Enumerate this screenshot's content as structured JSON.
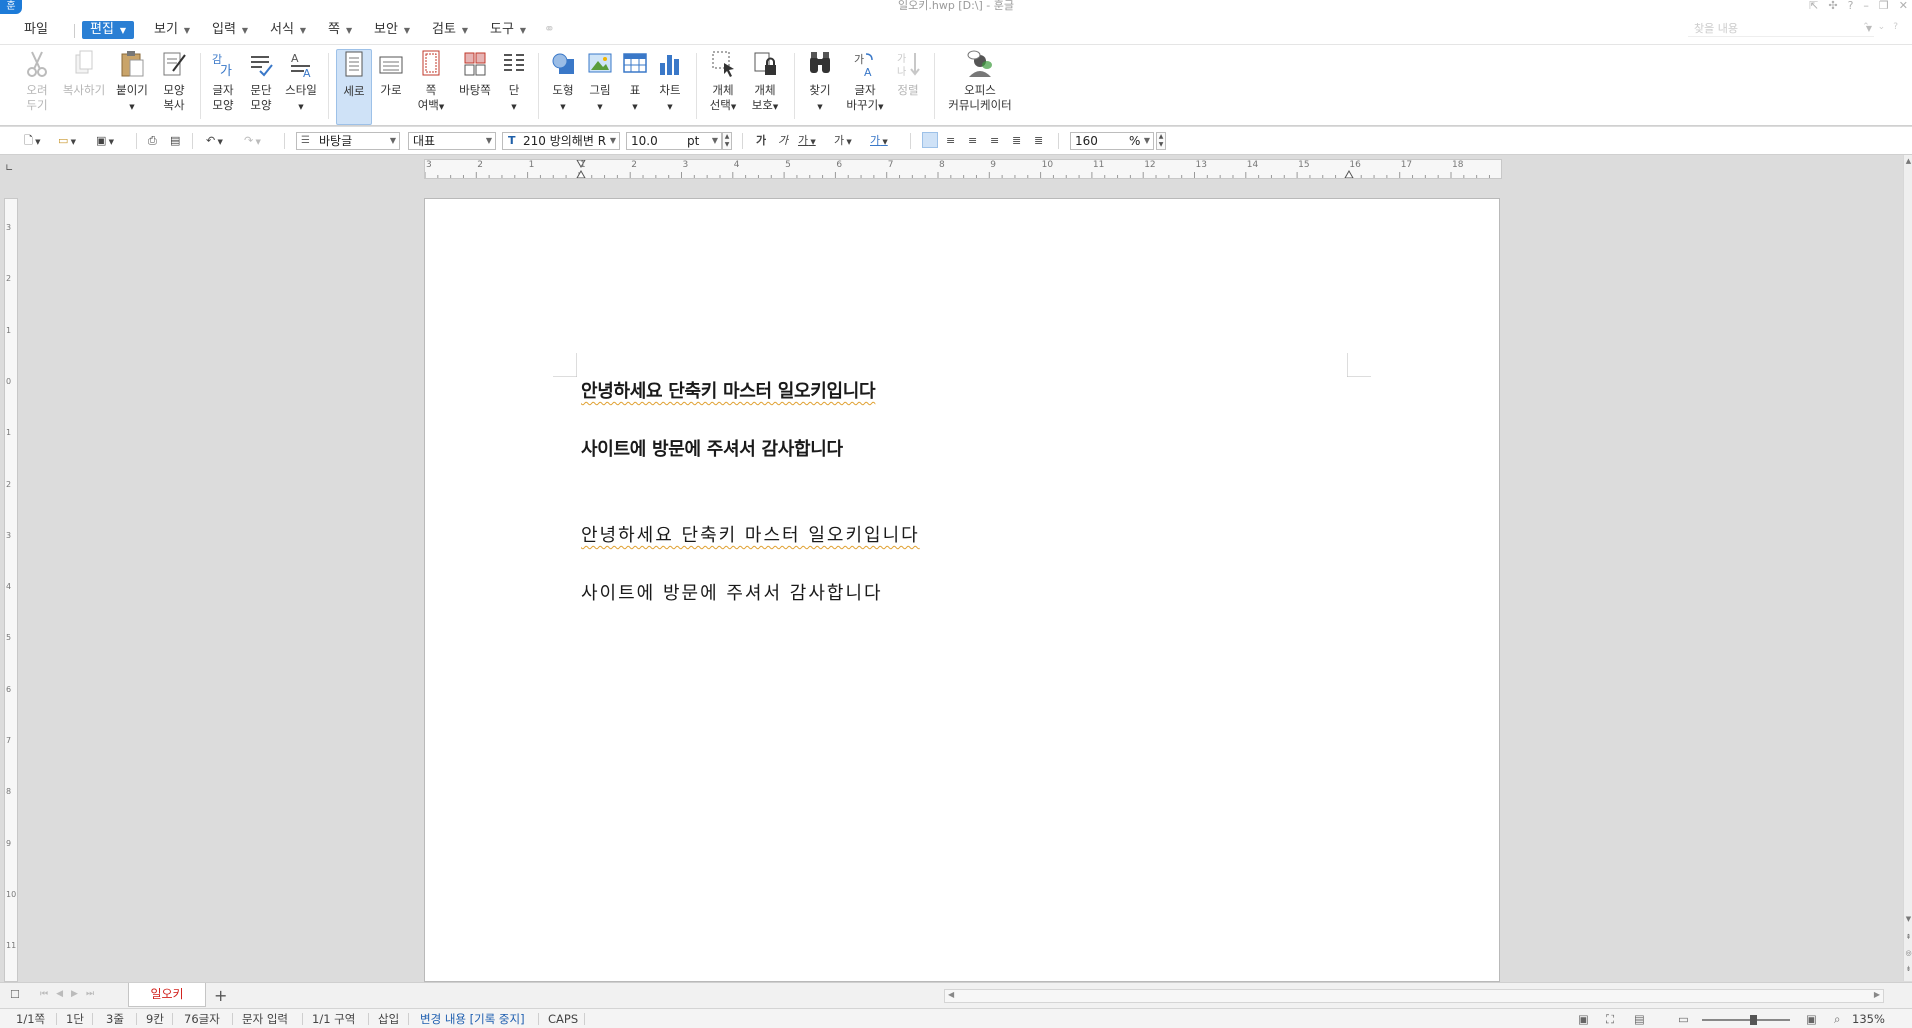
{
  "window": {
    "logo": "훈",
    "title": "일오키.hwp [D:\\] - 훈글",
    "controls": [
      "⇱",
      "✣",
      "?",
      "–",
      "❐",
      "✕"
    ]
  },
  "menu": {
    "file": "파일",
    "items": [
      {
        "label": "편집",
        "active": true
      },
      {
        "label": "보기"
      },
      {
        "label": "입력"
      },
      {
        "label": "서식"
      },
      {
        "label": "쪽"
      },
      {
        "label": "보안"
      },
      {
        "label": "검토"
      },
      {
        "label": "도구"
      }
    ],
    "search_placeholder": "찾을 내용",
    "right_controls": [
      "⌃",
      "⌄",
      "?"
    ]
  },
  "ribbon": {
    "cut": "오려\n두기",
    "copy": "복사하기",
    "paste": "붙이기",
    "format_copy": "모양\n복사",
    "char_shape": "글자\n모양",
    "para_shape": "문단\n모양",
    "style": "스타일",
    "portrait": "세로",
    "landscape": "가로",
    "page_margin": "쪽\n여백",
    "background_page": "바탕쪽",
    "columns": "단",
    "shape": "도형",
    "picture": "그림",
    "table": "표",
    "chart": "차트",
    "object_select": "개체\n선택",
    "object_protect": "개체\n보호",
    "find": "찾기",
    "char_change": "글자\n바꾸기",
    "sort": "정렬",
    "office_communicator": "오피스\n커뮤니케이터"
  },
  "toolbar": {
    "style_name": "바탕글",
    "lang": "대표",
    "font_name": "210 방의해변 R",
    "font_size": "10.0",
    "unit": "pt",
    "zoom": "160",
    "zoom_unit": "%"
  },
  "ruler": {
    "h_labels": [
      "3",
      "2",
      "1",
      "1",
      "2",
      "3",
      "4",
      "5",
      "6",
      "7",
      "8",
      "9",
      "10",
      "11",
      "12",
      "13",
      "14",
      "15",
      "16",
      "17",
      "18"
    ],
    "v_labels": [
      "3",
      "2",
      "1",
      "0",
      "1",
      "2",
      "3",
      "4",
      "5",
      "6",
      "7",
      "8",
      "9",
      "10",
      "11"
    ]
  },
  "document": {
    "lines": [
      "안녕하세요 단축키 마스터 일오키입니다",
      "사이트에 방문에 주셔서 감사합니다",
      "안녕하세요 단축키 마스터 일오키입니다",
      "사이트에 방문에 주셔서 감사합니다"
    ]
  },
  "tabs": {
    "doc_tab": "일오키",
    "add": "+"
  },
  "status": {
    "page": "1/1쪽",
    "column": "1단",
    "line": "3줄",
    "col": "9칸",
    "chars": "76글자",
    "mode": "문자 입력",
    "section": "1/1 구역",
    "insert": "삽입",
    "track": "변경 내용 [기록 중지]",
    "caps": "CAPS",
    "zoom": "135%"
  }
}
